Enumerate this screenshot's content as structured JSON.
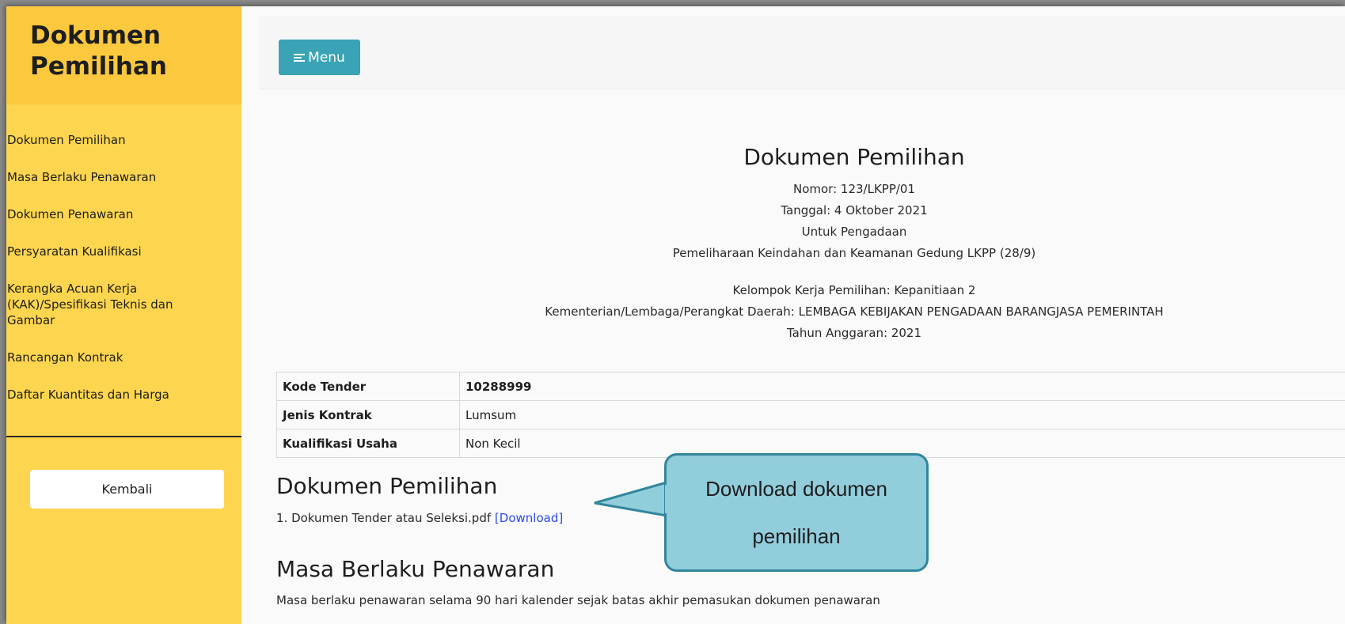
{
  "sidebar": {
    "title_line1": "Dokumen",
    "title_line2": "Pemilihan",
    "items": [
      {
        "label": "Dokumen Pemilihan"
      },
      {
        "label": "Masa Berlaku Penawaran"
      },
      {
        "label": "Dokumen Penawaran"
      },
      {
        "label": "Persyaratan Kualifikasi"
      },
      {
        "label": "Kerangka Acuan Kerja (KAK)/Spesifikasi Teknis dan Gambar"
      },
      {
        "label": "Rancangan Kontrak"
      },
      {
        "label": "Daftar Kuantitas dan Harga"
      }
    ],
    "back_label": "Kembali"
  },
  "topbar": {
    "menu_label": "Menu"
  },
  "document": {
    "heading": "Dokumen Pemilihan",
    "nomor": "Nomor: 123/LKPP/01",
    "tanggal": "Tanggal: 4 Oktober 2021",
    "untuk": "Untuk Pengadaan",
    "pengadaan": "Pemeliharaan Keindahan dan Keamanan Gedung LKPP (28/9)",
    "pokja": "Kelompok Kerja Pemilihan: Kepanitiaan 2",
    "kldi": "Kementerian/Lembaga/Perangkat Daerah: LEMBAGA KEBIJAKAN PENGADAAN BARANGJASA PEMERINTAH",
    "tahun": "Tahun Anggaran: 2021"
  },
  "info_table": [
    {
      "key": "Kode Tender",
      "value": "10288999"
    },
    {
      "key": "Jenis Kontrak",
      "value": "Lumsum"
    },
    {
      "key": "Kualifikasi Usaha",
      "value": "Non Kecil"
    }
  ],
  "sections": {
    "dokumen_title": "Dokumen Pemilihan",
    "file_name": "1. Dokumen Tender atau Seleksi.pdf",
    "download_label": "[Download]",
    "masa_title": "Masa Berlaku Penawaran",
    "masa_text": "Masa berlaku penawaran selama 90 hari kalender sejak batas akhir pemasukan dokumen penawaran"
  },
  "callout": {
    "line1": "Download dokumen",
    "line2": "pemilihan"
  },
  "colors": {
    "sidebar_bg": "#fdd54e",
    "sidebar_header": "#fbc83e",
    "menu_button": "#3aa3b5",
    "link": "#2c48e8",
    "callout_fill": "#92cddc",
    "callout_border": "#31869b"
  }
}
